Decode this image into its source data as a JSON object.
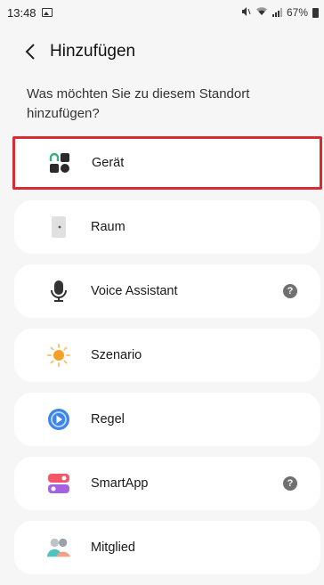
{
  "status": {
    "time": "13:48",
    "battery": "67%"
  },
  "header": {
    "title": "Hinzufügen"
  },
  "prompt": "Was möchten Sie zu diesem Standort hinzufügen?",
  "items": [
    {
      "label": "Gerät",
      "icon": "device-icon",
      "help": false,
      "selected": true
    },
    {
      "label": "Raum",
      "icon": "room-door-icon",
      "help": false
    },
    {
      "label": "Voice Assistant",
      "icon": "microphone-icon",
      "help": true,
      "help_text": "?"
    },
    {
      "label": "Szenario",
      "icon": "sun-icon",
      "help": false
    },
    {
      "label": "Regel",
      "icon": "automation-icon",
      "help": false
    },
    {
      "label": "SmartApp",
      "icon": "smartapp-icon",
      "help": true,
      "help_text": "?"
    },
    {
      "label": "Mitglied",
      "icon": "members-icon",
      "help": false
    }
  ],
  "colors": {
    "highlight": "#d92b32",
    "background": "#f6f6f6",
    "card": "#ffffff"
  }
}
